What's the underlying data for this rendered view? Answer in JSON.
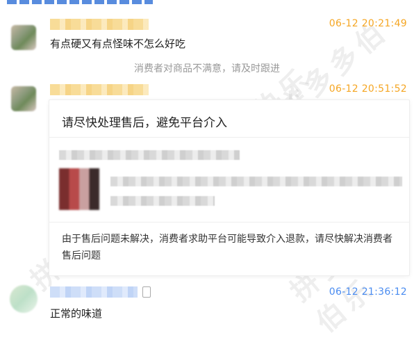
{
  "watermark": "拼多多伯乐",
  "messages": [
    {
      "time": "06-12 20:21:49",
      "text": "有点硬又有点怪味不怎么好吃"
    },
    {
      "time": "06-12 20:51:52"
    },
    {
      "time": "06-12 21:36:12",
      "text": "正常的味道"
    }
  ],
  "system_notice": "消费者对商品不满意，请及时跟进",
  "card": {
    "title": "请尽快处理售后，避免平台介入",
    "body": "由于售后问题未解决，消费者求助平台可能导致介入退款，请尽快解决消费者售后问题"
  },
  "colors": {
    "seller_time": "#f5a623",
    "buyer_time": "#4a8cf0"
  }
}
